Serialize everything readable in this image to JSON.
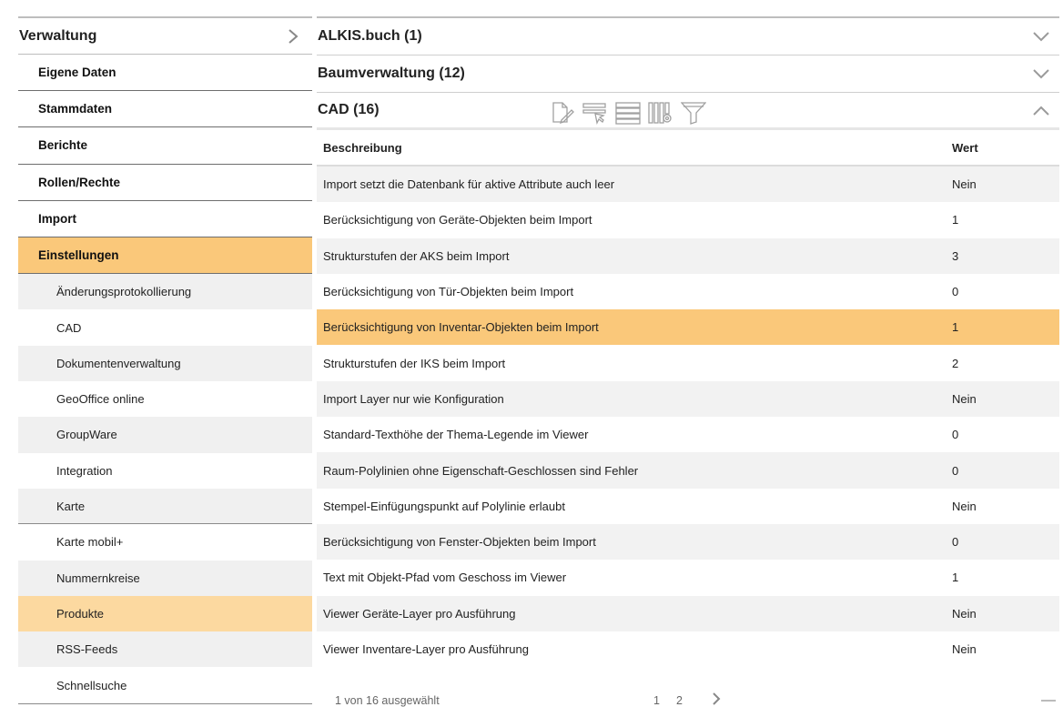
{
  "sidebar": {
    "header": "Verwaltung",
    "header_icon": "chevron-right-icon",
    "items": [
      {
        "label": "Eigene Daten"
      },
      {
        "label": "Stammdaten"
      },
      {
        "label": "Berichte"
      },
      {
        "label": "Rollen/Rechte"
      },
      {
        "label": "Import"
      },
      {
        "label": "Einstellungen",
        "active": true
      }
    ],
    "subitems": [
      {
        "label": "Änderungsprotokollierung"
      },
      {
        "label": "CAD"
      },
      {
        "label": "Dokumentenverwaltung"
      },
      {
        "label": "GeoOffice online"
      },
      {
        "label": "GroupWare"
      },
      {
        "label": "Integration"
      },
      {
        "label": "Karte"
      },
      {
        "label": "Karte mobil+"
      },
      {
        "label": "Nummernkreise"
      },
      {
        "label": "Produkte",
        "selected": true
      },
      {
        "label": "RSS-Feeds"
      },
      {
        "label": "Schnellsuche"
      }
    ]
  },
  "main": {
    "sections": [
      {
        "title": "ALKIS.buch (1)",
        "state": "collapsed"
      },
      {
        "title": "Baumverwaltung (12)",
        "state": "collapsed"
      },
      {
        "title": "CAD (16)",
        "state": "expanded"
      }
    ],
    "toolbar_icons": [
      "edit-document-icon",
      "clear-filter-icon",
      "rows-icon",
      "column-settings-icon",
      "filter-icon"
    ],
    "grid": {
      "columns": [
        "Beschreibung",
        "Wert"
      ],
      "rows": [
        {
          "desc": "Import setzt die Datenbank für aktive Attribute auch leer",
          "val": "Nein"
        },
        {
          "desc": "Berücksichtigung von Geräte-Objekten beim Import",
          "val": "1"
        },
        {
          "desc": "Strukturstufen der AKS beim Import",
          "val": "3"
        },
        {
          "desc": "Berücksichtigung von Tür-Objekten beim Import",
          "val": "0"
        },
        {
          "desc": "Berücksichtigung von Inventar-Objekten beim Import",
          "val": "1",
          "selected": true
        },
        {
          "desc": "Strukturstufen der IKS beim Import",
          "val": "2"
        },
        {
          "desc": "Import Layer nur wie Konfiguration",
          "val": "Nein"
        },
        {
          "desc": "Standard-Texthöhe der Thema-Legende im Viewer",
          "val": "0"
        },
        {
          "desc": "Raum-Polylinien ohne Eigenschaft-Geschlossen sind Fehler",
          "val": "0"
        },
        {
          "desc": "Stempel-Einfügungspunkt auf Polylinie erlaubt",
          "val": "Nein"
        },
        {
          "desc": "Berücksichtigung von Fenster-Objekten beim Import",
          "val": "0"
        },
        {
          "desc": "Text mit Objekt-Pfad vom Geschoss im Viewer",
          "val": "1"
        },
        {
          "desc": "Viewer Geräte-Layer pro Ausführung",
          "val": "Nein"
        },
        {
          "desc": "Viewer Inventare-Layer pro Ausführung",
          "val": "Nein"
        }
      ]
    },
    "pager": {
      "info": "1 von 16 ausgewählt",
      "pages": [
        "1",
        "2"
      ]
    }
  },
  "colors": {
    "active": "#fac87a",
    "selected_sub": "#fcd9a0",
    "row_alt": "#f2f2f2"
  }
}
